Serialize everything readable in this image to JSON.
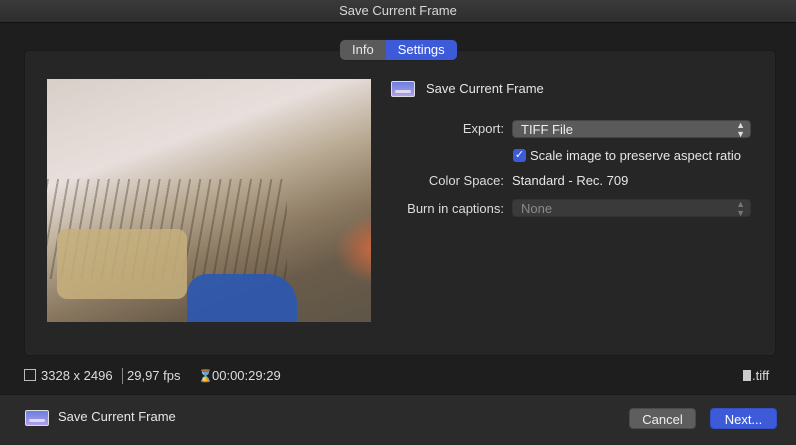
{
  "window": {
    "title": "Save Current Frame"
  },
  "tabs": [
    {
      "label": "Info"
    },
    {
      "label": "Settings"
    }
  ],
  "header": {
    "title": "Save Current Frame",
    "icon": "frame-icon"
  },
  "settings": {
    "export_label": "Export:",
    "export_value": "TIFF File",
    "scale_label": "Scale image to preserve aspect ratio",
    "scale_checked": true,
    "color_space_label": "Color Space:",
    "color_space_value": "Standard - Rec. 709",
    "captions_label": "Burn in captions:",
    "captions_value": "None"
  },
  "info_bar": {
    "resolution": "3328 x 2496",
    "fps": "29,97 fps",
    "timecode": "00:00:29:29",
    "extension": ".tiff"
  },
  "footer": {
    "title": "Save Current Frame",
    "cancel_label": "Cancel",
    "next_label": "Next..."
  },
  "colors": {
    "accent": "#3d5bd9",
    "background": "#1e1e1e",
    "panel": "#262626"
  }
}
